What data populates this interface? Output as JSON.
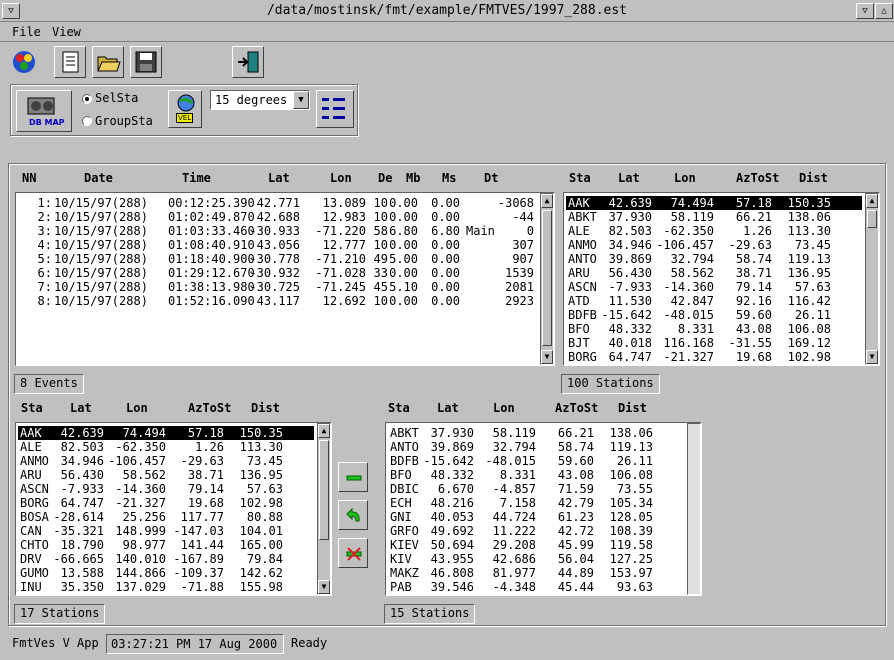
{
  "window": {
    "title": "/data/mostinsk/fmt/example/FMTVES/1997_288.est"
  },
  "menu": [
    "File",
    "View"
  ],
  "toolbar": {
    "select": {
      "sel_sta": "SelSta",
      "group_sta": "GroupSta",
      "selected": "SelSta"
    },
    "degrees": "15 degrees",
    "db_map_label": "DB MAP",
    "vel_label": "VEL"
  },
  "events": {
    "headers": [
      "NN",
      "Date",
      "Time",
      "Lat",
      "Lon",
      "De",
      "Mb",
      "Ms",
      "Dt"
    ],
    "rows": [
      [
        "1:",
        "10/15/97(288)",
        "00:12:25.390",
        "42.771",
        "13.089",
        "10",
        "0.00",
        "0.00",
        "",
        "-3068"
      ],
      [
        "2:",
        "10/15/97(288)",
        "01:02:49.870",
        "42.688",
        "12.983",
        "10",
        "0.00",
        "0.00",
        "",
        "-44"
      ],
      [
        "3:",
        "10/15/97(288)",
        "01:03:33.460",
        "-30.933",
        "-71.220",
        "58",
        "6.80",
        "6.80",
        "Main",
        "0"
      ],
      [
        "4:",
        "10/15/97(288)",
        "01:08:40.910",
        "43.056",
        "12.777",
        "10",
        "0.00",
        "0.00",
        "",
        "307"
      ],
      [
        "5:",
        "10/15/97(288)",
        "01:18:40.900",
        "-30.778",
        "-71.210",
        "49",
        "5.00",
        "0.00",
        "",
        "907"
      ],
      [
        "6:",
        "10/15/97(288)",
        "01:29:12.670",
        "-30.932",
        "-71.028",
        "33",
        "0.00",
        "0.00",
        "",
        "1539"
      ],
      [
        "7:",
        "10/15/97(288)",
        "01:38:13.980",
        "-30.725",
        "-71.245",
        "45",
        "5.10",
        "0.00",
        "",
        "2081"
      ],
      [
        "8:",
        "10/15/97(288)",
        "01:52:16.090",
        "43.117",
        "12.692",
        "10",
        "0.00",
        "0.00",
        "",
        "2923"
      ]
    ],
    "count_label": "8 Events"
  },
  "all_stations": {
    "headers": [
      "Sta",
      "Lat",
      "Lon",
      "AzToSt",
      "Dist"
    ],
    "rows": [
      [
        "AAK",
        "42.639",
        "74.494",
        "57.18",
        "150.35"
      ],
      [
        "ABKT",
        "37.930",
        "58.119",
        "66.21",
        "138.06"
      ],
      [
        "ALE",
        "82.503",
        "-62.350",
        "1.26",
        "113.30"
      ],
      [
        "ANMO",
        "34.946",
        "-106.457",
        "-29.63",
        "73.45"
      ],
      [
        "ANTO",
        "39.869",
        "32.794",
        "58.74",
        "119.13"
      ],
      [
        "ARU",
        "56.430",
        "58.562",
        "38.71",
        "136.95"
      ],
      [
        "ASCN",
        "-7.933",
        "-14.360",
        "79.14",
        "57.63"
      ],
      [
        "ATD",
        "11.530",
        "42.847",
        "92.16",
        "116.42"
      ],
      [
        "BDFB",
        "-15.642",
        "-48.015",
        "59.60",
        "26.11"
      ],
      [
        "BFO",
        "48.332",
        "8.331",
        "43.08",
        "106.08"
      ],
      [
        "BJT",
        "40.018",
        "116.168",
        "-31.55",
        "169.12"
      ],
      [
        "BORG",
        "64.747",
        "-21.327",
        "19.68",
        "102.98"
      ]
    ],
    "selected_index": 0,
    "count_label": "100 Stations"
  },
  "selected_stations": {
    "headers": [
      "Sta",
      "Lat",
      "Lon",
      "AzToSt",
      "Dist"
    ],
    "rows": [
      [
        "AAK",
        "42.639",
        "74.494",
        "57.18",
        "150.35"
      ],
      [
        "ALE",
        "82.503",
        "-62.350",
        "1.26",
        "113.30"
      ],
      [
        "ANMO",
        "34.946",
        "-106.457",
        "-29.63",
        "73.45"
      ],
      [
        "ARU",
        "56.430",
        "58.562",
        "38.71",
        "136.95"
      ],
      [
        "ASCN",
        "-7.933",
        "-14.360",
        "79.14",
        "57.63"
      ],
      [
        "BORG",
        "64.747",
        "-21.327",
        "19.68",
        "102.98"
      ],
      [
        "BOSA",
        "-28.614",
        "25.256",
        "117.77",
        "80.88"
      ],
      [
        "CAN",
        "-35.321",
        "148.999",
        "-147.03",
        "104.01"
      ],
      [
        "CHTO",
        "18.790",
        "98.977",
        "141.44",
        "165.00"
      ],
      [
        "DRV",
        "-66.665",
        "140.010",
        "-167.89",
        "79.84"
      ],
      [
        "GUMO",
        "13.588",
        "144.866",
        "-109.37",
        "142.62"
      ],
      [
        "INU",
        "35.350",
        "137.029",
        "-71.88",
        "155.98"
      ]
    ],
    "selected_index": 0,
    "count_label": "17 Stations"
  },
  "group_stations": {
    "headers": [
      "Sta",
      "Lat",
      "Lon",
      "AzToSt",
      "Dist"
    ],
    "rows": [
      [
        "ABKT",
        "37.930",
        "58.119",
        "66.21",
        "138.06"
      ],
      [
        "ANTO",
        "39.869",
        "32.794",
        "58.74",
        "119.13"
      ],
      [
        "BDFB",
        "-15.642",
        "-48.015",
        "59.60",
        "26.11"
      ],
      [
        "BFO",
        "48.332",
        "8.331",
        "43.08",
        "106.08"
      ],
      [
        "DBIC",
        "6.670",
        "-4.857",
        "71.59",
        "73.55"
      ],
      [
        "ECH",
        "48.216",
        "7.158",
        "42.79",
        "105.34"
      ],
      [
        "GNI",
        "40.053",
        "44.724",
        "61.23",
        "128.05"
      ],
      [
        "GRFO",
        "49.692",
        "11.222",
        "42.72",
        "108.39"
      ],
      [
        "KIEV",
        "50.694",
        "29.208",
        "45.99",
        "119.58"
      ],
      [
        "KIV",
        "43.955",
        "42.686",
        "56.04",
        "127.25"
      ],
      [
        "MAKZ",
        "46.808",
        "81.977",
        "44.89",
        "153.97"
      ],
      [
        "PAB",
        "39.546",
        "-4.348",
        "45.44",
        "93.63"
      ]
    ],
    "count_label": "15 Stations"
  },
  "status": {
    "app": "FmtVes V App",
    "datetime": "03:27:21 PM  17 Aug 2000",
    "state": "Ready"
  }
}
